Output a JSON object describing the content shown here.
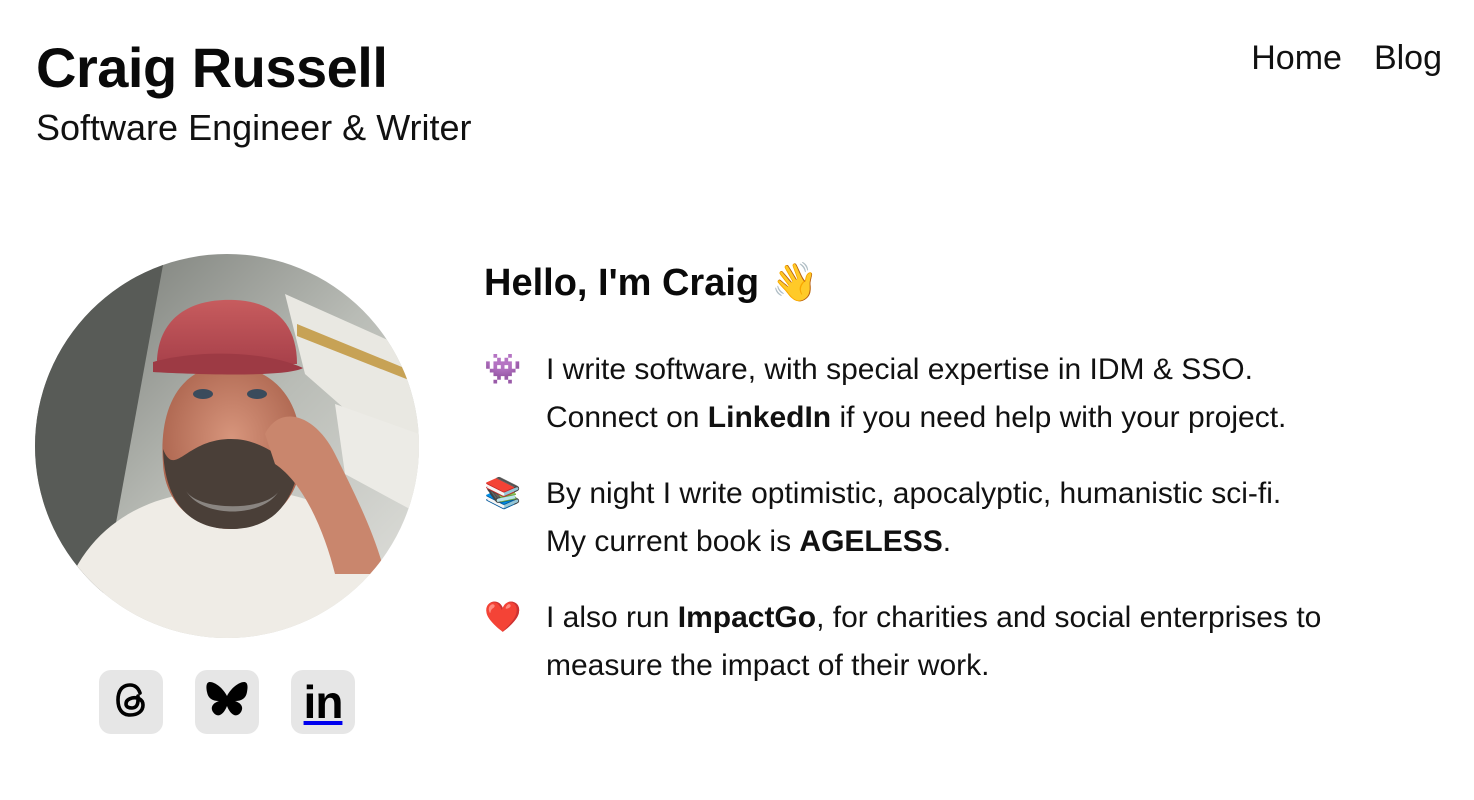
{
  "header": {
    "title": "Craig Russell",
    "subtitle": "Software Engineer & Writer"
  },
  "nav": {
    "home": "Home",
    "blog": "Blog"
  },
  "intro": {
    "greeting": "Hello, I'm Craig",
    "greeting_emoji": "👋",
    "items": [
      {
        "icon": "👾",
        "icon_name": "alien-monster-icon",
        "line1": "I write software, with special expertise in IDM & SSO.",
        "line2_before": "Connect on ",
        "line2_link": "LinkedIn",
        "line2_after": " if you need help with your project."
      },
      {
        "icon": "📚",
        "icon_name": "books-icon",
        "line1": "By night I write optimistic, apocalyptic, humanistic sci-fi.",
        "line2_before": "My current book is ",
        "line2_link": "AGELESS",
        "line2_after": "."
      },
      {
        "icon": "❤️",
        "icon_name": "heart-icon",
        "line1_before": "I also run ",
        "line1_link": "ImpactGo",
        "line1_after": ", for charities and social enterprises to",
        "line2": "measure the impact of their work."
      }
    ]
  },
  "socials": [
    {
      "name": "threads-icon"
    },
    {
      "name": "bluesky-icon"
    },
    {
      "name": "linkedin-icon",
      "label": "in"
    }
  ]
}
